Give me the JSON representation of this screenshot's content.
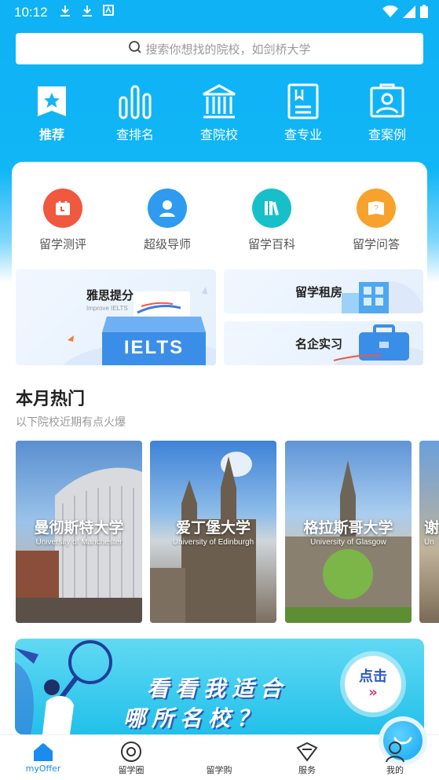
{
  "status": {
    "time": "10:12"
  },
  "search": {
    "placeholder": "搜索你想找的院校，如剑桥大学"
  },
  "nav": [
    {
      "label": "推荐",
      "icon": "star-bookmark-icon",
      "active": true
    },
    {
      "label": "查排名",
      "icon": "bar-chart-icon"
    },
    {
      "label": "查院校",
      "icon": "university-building-icon"
    },
    {
      "label": "查专业",
      "icon": "document-icon"
    },
    {
      "label": "查案例",
      "icon": "case-portrait-icon"
    }
  ],
  "quick": [
    {
      "label": "留学测评",
      "icon": "calendar-icon",
      "color": "#f0583f"
    },
    {
      "label": "超级导师",
      "icon": "tutor-icon",
      "color": "#2e9bf0"
    },
    {
      "label": "留学百科",
      "icon": "books-icon",
      "color": "#17c0c8"
    },
    {
      "label": "留学问答",
      "icon": "question-book-icon",
      "color": "#f7a22c"
    }
  ],
  "promos": {
    "ielts": {
      "title": "雅思提分",
      "sub": "Improve IELTS",
      "badge": "IELTS"
    },
    "rent": {
      "title": "留学租房"
    },
    "intern": {
      "title": "名企实习"
    }
  },
  "hot": {
    "title": "本月热门",
    "sub": "以下院校近期有点火爆",
    "items": [
      {
        "cn": "曼彻斯特大学",
        "en": "University of Manchester"
      },
      {
        "cn": "爱丁堡大学",
        "en": "University of Edinburgh"
      },
      {
        "cn": "格拉斯哥大学",
        "en": "University of Glasgow"
      },
      {
        "cn": "谢",
        "en": "Un"
      }
    ]
  },
  "banner": {
    "line1": "看看我适合",
    "line2": "哪所名校？",
    "cta": "点击"
  },
  "tabs": [
    {
      "label": "myOffer",
      "icon": "home-icon",
      "active": true
    },
    {
      "label": "留学圈",
      "icon": "circle-icon"
    },
    {
      "label": "留学购",
      "icon": "shop-icon"
    },
    {
      "label": "服务",
      "icon": "service-icon"
    },
    {
      "label": "我的",
      "icon": "profile-icon"
    }
  ]
}
